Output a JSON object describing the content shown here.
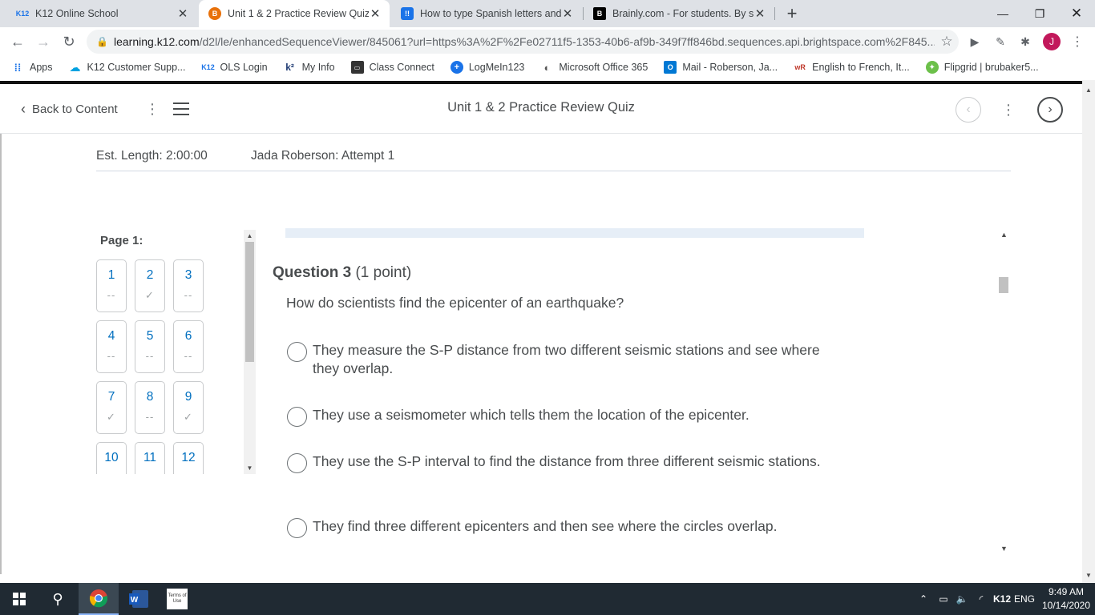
{
  "browser": {
    "tabs": [
      {
        "title": "K12 Online School",
        "favicon": "K12",
        "active": false
      },
      {
        "title": "Unit 1 & 2 Practice Review Quiz",
        "favicon": "B",
        "active": true
      },
      {
        "title": "How to type Spanish letters and",
        "favicon": "!!",
        "active": false
      },
      {
        "title": "Brainly.com - For students. By stu",
        "favicon": "B",
        "active": false
      }
    ],
    "url_host": "learning.k12.com",
    "url_path": "/d2l/le/enhancedSequenceViewer/845061?url=https%3A%2F%2Fe02711f5-1353-40b6-af9b-349f7ff846bd.sequences.api.brightspace.com%2F845...",
    "profile_initial": "J",
    "bookmarks": [
      {
        "label": "Apps",
        "icon": "apps-grid-icon"
      },
      {
        "label": "K12 Customer Supp...",
        "icon": "salesforce-icon"
      },
      {
        "label": "OLS Login",
        "icon": "k12-icon"
      },
      {
        "label": "My Info",
        "icon": "k12-mark-icon"
      },
      {
        "label": "Class Connect",
        "icon": "class-connect-icon"
      },
      {
        "label": "LogMeIn123",
        "icon": "logmein-icon"
      },
      {
        "label": "Microsoft Office 365",
        "icon": "office-icon"
      },
      {
        "label": "Mail - Roberson, Ja...",
        "icon": "outlook-icon"
      },
      {
        "label": "English to French, It...",
        "icon": "wordreference-icon"
      },
      {
        "label": "Flipgrid | brubaker5...",
        "icon": "flipgrid-icon"
      }
    ]
  },
  "d2l": {
    "back_label": "Back to Content",
    "title": "Unit 1 & 2 Practice Review Quiz"
  },
  "quiz": {
    "est_length": "Est. Length: 2:00:00",
    "attempt": "Jada Roberson: Attempt 1",
    "page_label": "Page 1:",
    "question_nav": [
      {
        "num": "1",
        "status": "--"
      },
      {
        "num": "2",
        "status": "✓"
      },
      {
        "num": "3",
        "status": "--"
      },
      {
        "num": "4",
        "status": "--"
      },
      {
        "num": "5",
        "status": "--"
      },
      {
        "num": "6",
        "status": "--"
      },
      {
        "num": "7",
        "status": "✓"
      },
      {
        "num": "8",
        "status": "--"
      },
      {
        "num": "9",
        "status": "✓"
      },
      {
        "num": "10",
        "status": ""
      },
      {
        "num": "11",
        "status": ""
      },
      {
        "num": "12",
        "status": ""
      }
    ],
    "question_label": "Question 3",
    "question_points": "(1 point)",
    "question_text": "How do scientists find the epicenter of an earthquake?",
    "options": [
      "They measure the S-P distance from two different seismic stations and see where they overlap.",
      "They use a seismometer which tells them the location of the epicenter.",
      "They use the S-P interval to find the distance from three different seismic stations.",
      "They find three different epicenters and then see where the circles overlap."
    ]
  },
  "taskbar": {
    "tray_k12": "K12",
    "tray_lang": "ENG",
    "time": "9:49 AM",
    "date": "10/14/2020",
    "terms_label": "Terms of Use"
  }
}
